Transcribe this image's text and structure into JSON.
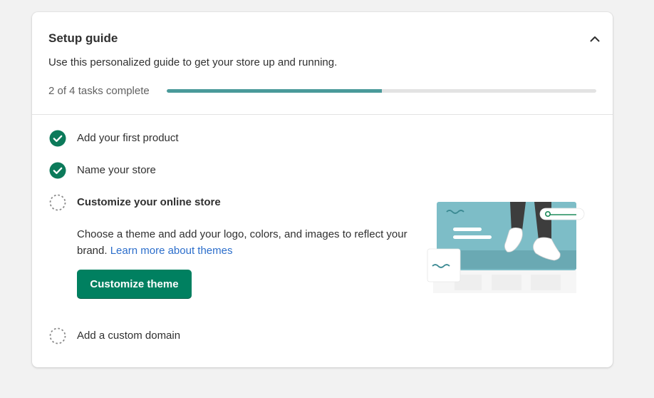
{
  "setup_guide": {
    "title": "Setup guide",
    "subtitle": "Use this personalized guide to get your store up and running.",
    "progress_text": "2 of 4 tasks complete",
    "progress_fraction": 0.5,
    "collapse_icon": "chevron-up-icon"
  },
  "tasks": [
    {
      "label": "Add your first product",
      "status": "complete",
      "icon": "checkmark-circle-icon"
    },
    {
      "label": "Name your store",
      "status": "complete",
      "icon": "checkmark-circle-icon"
    },
    {
      "label": "Customize your online store",
      "status": "incomplete",
      "expanded": true,
      "icon": "dashed-circle-icon",
      "description": "Choose a theme and add your logo, colors, and images to reflect your brand.",
      "link_text": "Learn more about themes",
      "button_label": "Customize theme",
      "illustration": "online-store-illustration"
    },
    {
      "label": "Add a custom domain",
      "status": "incomplete",
      "icon": "dashed-circle-icon"
    }
  ],
  "colors": {
    "accent_green": "#008060",
    "check_green": "#0c7a5a",
    "progress_teal": "#4a9a9a",
    "link_blue": "#2c6ecb",
    "page_bg": "#f2f2f2"
  }
}
